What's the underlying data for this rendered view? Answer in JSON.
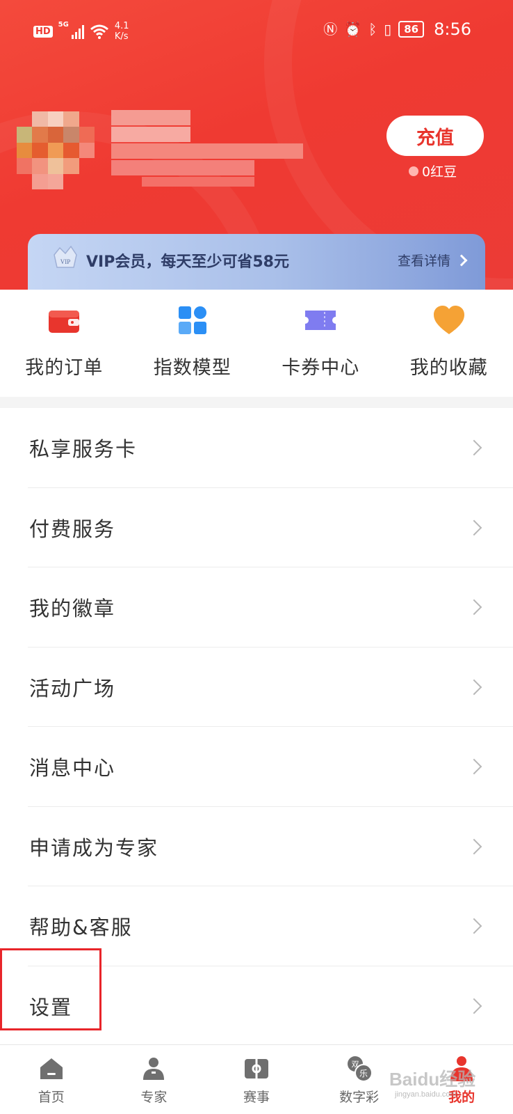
{
  "status_bar": {
    "hd": "HD",
    "network": "5G",
    "speed_value": "4.1",
    "speed_unit": "K/s",
    "battery": "86",
    "time": "8:56"
  },
  "profile": {
    "recharge_label": "充值",
    "beans_text": "0红豆"
  },
  "vip_banner": {
    "crown_text": "VIP",
    "text": "VIP会员，每天至少可省58元",
    "detail_label": "查看详情"
  },
  "quick_actions": [
    {
      "label": "我的订单",
      "icon": "wallet-icon"
    },
    {
      "label": "指数模型",
      "icon": "grid-icon"
    },
    {
      "label": "卡券中心",
      "icon": "ticket-icon"
    },
    {
      "label": "我的收藏",
      "icon": "heart-icon"
    }
  ],
  "menu": [
    {
      "label": "私享服务卡"
    },
    {
      "label": "付费服务"
    },
    {
      "label": "我的徽章"
    },
    {
      "label": "活动广场"
    },
    {
      "label": "消息中心"
    },
    {
      "label": "申请成为专家"
    },
    {
      "label": "帮助&客服"
    },
    {
      "label": "设置"
    }
  ],
  "tabbar": [
    {
      "label": "首页",
      "icon": "home-icon",
      "active": false
    },
    {
      "label": "专家",
      "icon": "expert-icon",
      "active": false
    },
    {
      "label": "赛事",
      "icon": "match-icon",
      "active": false
    },
    {
      "label": "数字彩",
      "icon": "lottery-icon",
      "active": false,
      "badge_top": "双",
      "badge_bottom": "乐"
    },
    {
      "label": "我的",
      "icon": "profile-icon",
      "active": true
    }
  ],
  "watermark": {
    "main": "Baidu经验",
    "sub": "jingyan.baidu.com"
  },
  "colors": {
    "brand_red": "#ef3a32",
    "vip_blue": "#a9bfe9",
    "highlight": "#e8252a"
  }
}
